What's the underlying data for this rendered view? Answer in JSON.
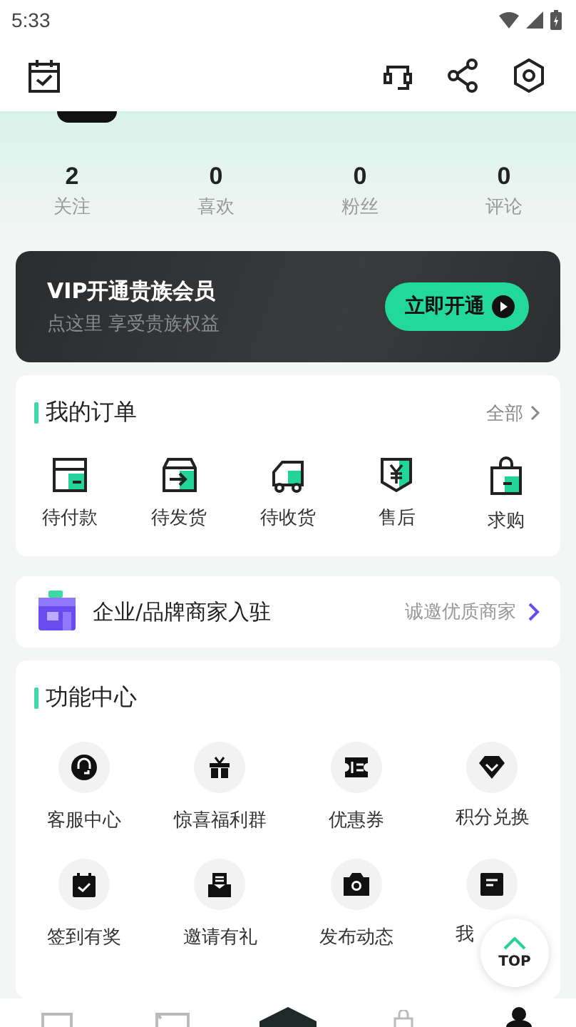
{
  "status_bar": {
    "time": "5:33"
  },
  "stats": [
    {
      "value": "2",
      "label": "关注"
    },
    {
      "value": "0",
      "label": "喜欢"
    },
    {
      "value": "0",
      "label": "粉丝"
    },
    {
      "value": "0",
      "label": "评论"
    }
  ],
  "vip": {
    "title": "VIP开通贵族会员",
    "subtitle": "点这里 享受贵族权益",
    "button": "立即开通"
  },
  "orders": {
    "title": "我的订单",
    "more": "全部",
    "items": [
      {
        "kind": "pay",
        "label": "待付款"
      },
      {
        "kind": "ship",
        "label": "待发货"
      },
      {
        "kind": "receive",
        "label": "待收货"
      },
      {
        "kind": "refund",
        "label": "售后"
      },
      {
        "kind": "buy",
        "label": "求购"
      }
    ]
  },
  "merchant": {
    "title": "企业/品牌商家入驻",
    "link": "诚邀优质商家"
  },
  "functions": {
    "title": "功能中心",
    "items": [
      {
        "kind": "service",
        "label": "客服中心"
      },
      {
        "kind": "gift",
        "label": "惊喜福利群"
      },
      {
        "kind": "coupon",
        "label": "优惠券"
      },
      {
        "kind": "diamond",
        "label": "积分兑换"
      },
      {
        "kind": "checkin",
        "label": "签到有奖"
      },
      {
        "kind": "invite",
        "label": "邀请有礼"
      },
      {
        "kind": "camera",
        "label": "发布动态"
      },
      {
        "kind": "note",
        "label": "我"
      }
    ]
  },
  "top_button": "TOP",
  "bottom_nav": [
    {
      "kind": "home",
      "selected": false
    },
    {
      "kind": "market",
      "selected": false
    },
    {
      "kind": "center",
      "selected": false
    },
    {
      "kind": "bag",
      "selected": false
    },
    {
      "kind": "me",
      "selected": true
    }
  ]
}
